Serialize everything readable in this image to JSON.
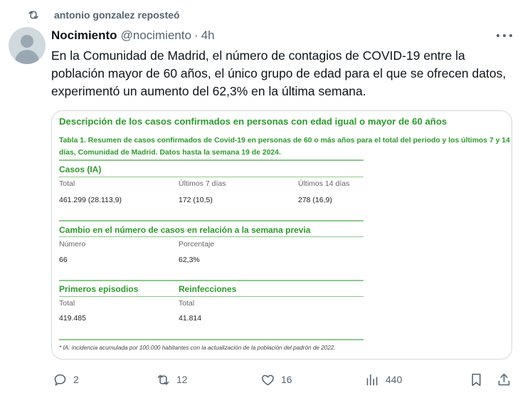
{
  "repost": {
    "text": "antonio gonzalez reposteó",
    "icon": "repost-icon"
  },
  "tweet": {
    "author_name": "Nocimiento",
    "handle": "@nocimiento",
    "separator": "·",
    "time": "4h",
    "text": "En la Comunidad de Madrid, el número de contagios de COVID-19 entre la población mayor de 60 años, el único grupo de edad para el que se ofrecen datos, experimentó un aumento del 62,3% en la última semana."
  },
  "media": {
    "title": "Descripción de los casos confirmados en personas con edad igual o mayor de 60 años",
    "caption": "Tabla 1. Resumen de casos confirmados de Covid-19 en personas de 60 o más años para el total del periodo y los últimos 7 y 14 días, Comunidad de Madrid. Datos hasta la semana 19 de 2024.",
    "casos": {
      "heading": "Casos (IA)",
      "labels": [
        "Total",
        "Últimos 7 días",
        "Últimos 14 días"
      ],
      "values": [
        "461.299 (28.113,9)",
        "172 (10,5)",
        "278 (16,9)"
      ]
    },
    "cambio": {
      "heading": "Cambio en el número de casos en relación a la semana previa",
      "labels": [
        "Número",
        "Porcentaje"
      ],
      "values": [
        "66",
        "62,3%"
      ]
    },
    "episodios": {
      "primeros_heading": "Primeros episodios",
      "reinfecciones_heading": "Reinfecciones",
      "labels": [
        "Total",
        "Total"
      ],
      "values": [
        "419.485",
        "41.814"
      ]
    },
    "footnote": "* IA: incidencia acumulada por 100.000 habitantes con la actualización de la población del padrón de 2022.",
    "accent_color": "#2e9a2e"
  },
  "actions": {
    "replies": "2",
    "reposts": "12",
    "likes": "16",
    "views": "440"
  },
  "colors": {
    "text": "#0f1419",
    "muted": "#536471",
    "border": "#cfd9de"
  }
}
